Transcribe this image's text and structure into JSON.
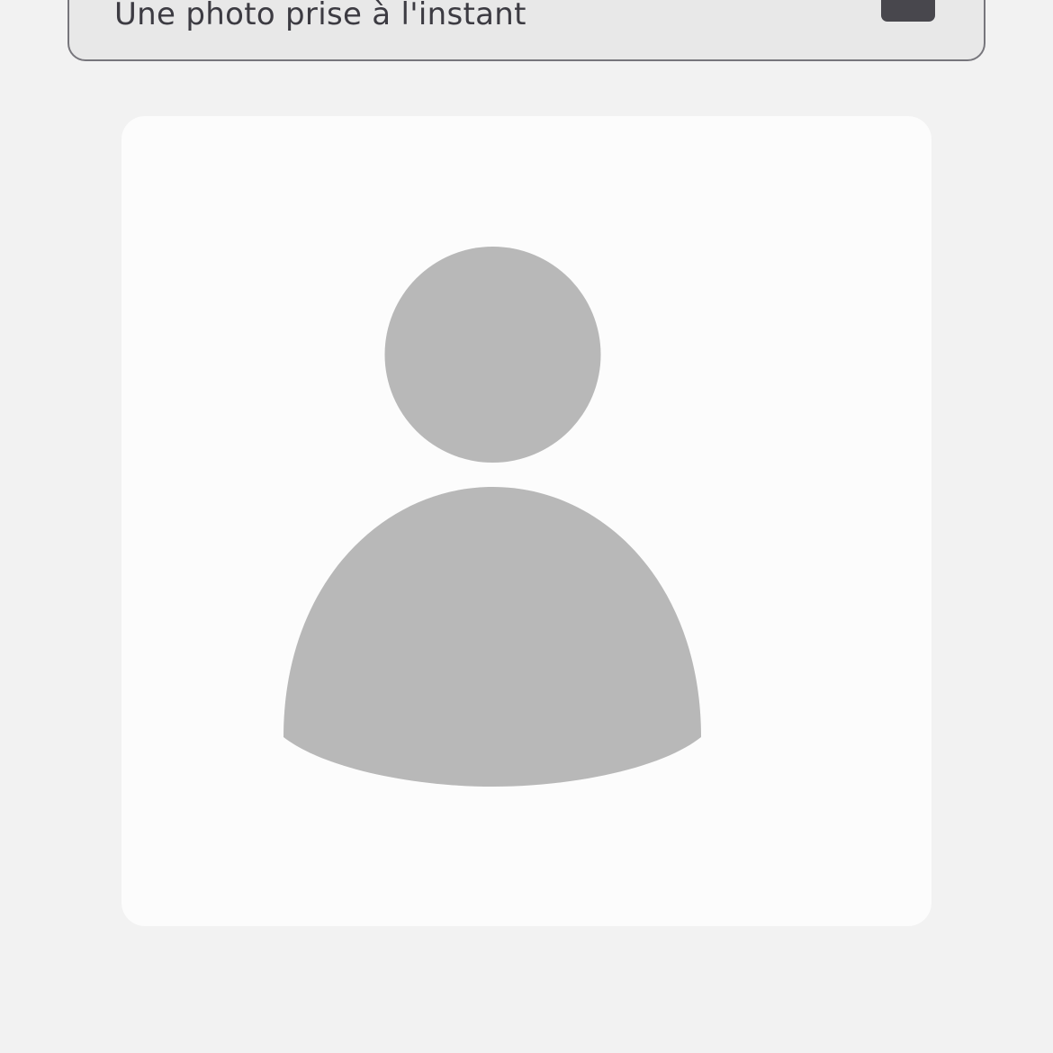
{
  "photo_option": {
    "label": "Une photo prise à l'instant",
    "icon": "camera-icon"
  },
  "avatar": {
    "icon": "user-placeholder-icon",
    "fill_color": "#b8b8b8",
    "card_color": "#fcfcfc"
  },
  "colors": {
    "background": "#f2f2f2",
    "option_background": "#e8e8e8",
    "option_border": "#77767c",
    "text": "#3c3b42",
    "icon": "#48474d"
  }
}
